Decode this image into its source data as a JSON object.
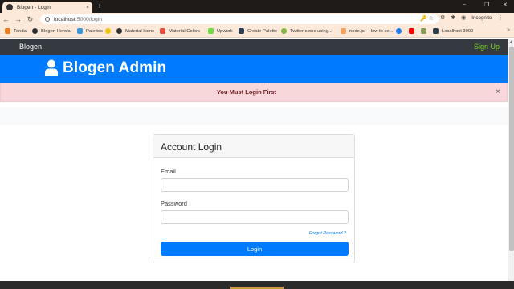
{
  "browser": {
    "tab_title": "Blogen - Login",
    "tab_close": "×",
    "new_tab": "+",
    "url_host": "localhost",
    "url_path": ":5000/login",
    "profile_label": "Incognito",
    "window_controls": [
      "–",
      "❐",
      "✕"
    ]
  },
  "bookmarks": [
    {
      "label": "Tenda",
      "color": "#e67e22"
    },
    {
      "label": "Blogen Heroku",
      "color": "#333333"
    },
    {
      "label": "Palettes",
      "color": "#3498db"
    },
    {
      "label": "",
      "color": "#f1c40f"
    },
    {
      "label": "Material Icons",
      "color": "#333333"
    },
    {
      "label": "Material Colors",
      "color": "#e74c3c"
    },
    {
      "label": "Upwork",
      "color": "#6fda44"
    },
    {
      "label": "Create Palette",
      "color": "#2c3e50"
    },
    {
      "label": "Twitter clone using...",
      "color": "#7cb342"
    },
    {
      "label": "node.js - How to se...",
      "color": "#f4a460"
    },
    {
      "label": "",
      "color": "#1877f2"
    },
    {
      "label": "",
      "color": "#ff0000"
    },
    {
      "label": "",
      "color": "#8a9a5b"
    },
    {
      "label": "Localhost 3000",
      "color": "#2c3e50"
    }
  ],
  "bookmarks_more": "»",
  "navbar": {
    "brand": "Blogen",
    "signup": "Sign Up"
  },
  "header": {
    "title": "Blogen Admin"
  },
  "alert": {
    "message": "You Must Login First",
    "close": "×"
  },
  "login_card": {
    "title": "Account Login",
    "email_label": "Email",
    "password_label": "Password",
    "forgot_link": "Forgot Password ?",
    "submit_label": "Login"
  },
  "colors": {
    "primary": "#007bff",
    "navbar": "#343a40",
    "signup": "#7ed321",
    "alert_bg": "#f8d7da",
    "alert_text": "#721c24"
  }
}
